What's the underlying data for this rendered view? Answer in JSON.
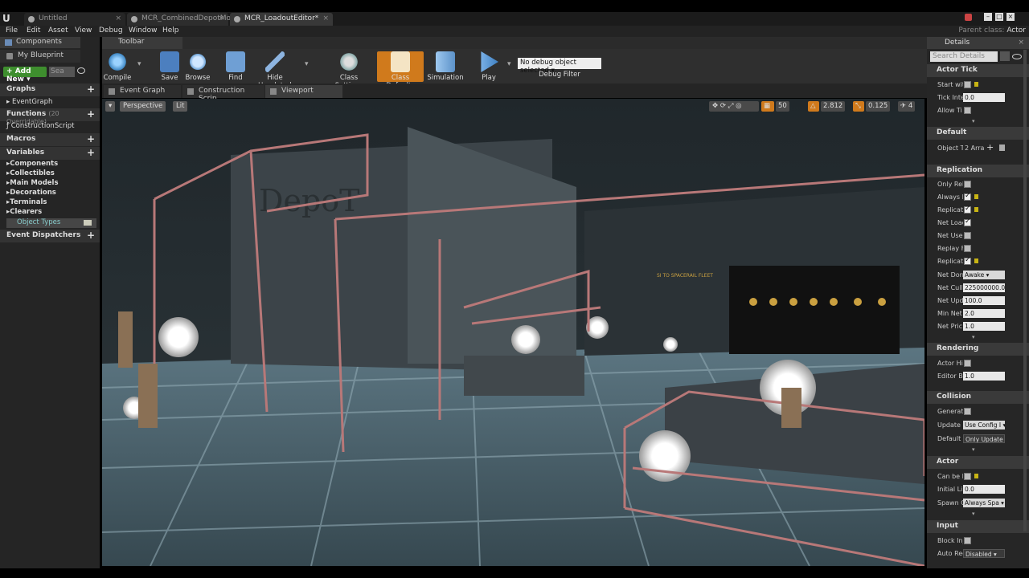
{
  "tabs": [
    "Untitled",
    "MCR_CombinedDepotMoc",
    "MCR_LoadoutEditor*"
  ],
  "menu": [
    "File",
    "Edit",
    "Asset",
    "View",
    "Debug",
    "Window",
    "Help"
  ],
  "parent_class": {
    "label": "Parent class:",
    "value": "Actor"
  },
  "left": {
    "components_tab": "Components",
    "blueprint_name": "My Blueprint",
    "add_new": "Add New",
    "search_placeholder": "Sea",
    "graphs": "Graphs",
    "event_graph": "EventGraph",
    "functions": "Functions",
    "functions_count": "(20 Overridable)",
    "construction_script": "ConstructionScript",
    "macros": "Macros",
    "variables": "Variables",
    "var_items": [
      "Components",
      "Collectibles",
      "Main Models",
      "Decorations",
      "Terminals",
      "Clearers"
    ],
    "object_types": "Object Types",
    "event_dispatchers": "Event Dispatchers"
  },
  "toolbar": {
    "tab": "Toolbar",
    "buttons": [
      "Compile",
      "Save",
      "Browse",
      "Find",
      "Hide Unrelated",
      "Class Settings",
      "Class Defaults",
      "Simulation",
      "Play"
    ],
    "debug_select": "No debug object selected",
    "debug_filter": "Debug Filter"
  },
  "editor_tabs": [
    "Event Graph",
    "Construction Scrip",
    "Viewport"
  ],
  "viewport": {
    "perspective": "Perspective",
    "lit": "Lit",
    "grid": "50",
    "angle": "2.812",
    "scale": "0.125",
    "speed": "4",
    "sign_text": "DepoT",
    "banner_text": "SI TO SPACERAIL FLEET"
  },
  "details": {
    "title": "Details",
    "search_placeholder": "Search Details",
    "sections": {
      "actor_tick": "Actor Tick",
      "default": "Default",
      "replication": "Replication",
      "rendering": "Rendering",
      "collision": "Collision",
      "actor": "Actor",
      "input": "Input"
    },
    "rows": {
      "start_with": "Start wit",
      "tick_interval": "Tick Inte",
      "tick_val": "0.0",
      "allow_tick": "Allow Ti",
      "object_t": "Object T",
      "object_val": "2 Arra",
      "only_rel": "Only Rel",
      "always_rel": "Always R",
      "replicates": "Replicat",
      "net_load": "Net Load",
      "net_use": "Net Use",
      "replay": "Replay F",
      "replicate_m": "Replicat",
      "net_dorm": "Net Dorr",
      "net_dorm_val": "Awake",
      "net_cull": "Net Cull",
      "net_cull_val": "225000000.0",
      "net_upd": "Net Upd",
      "net_upd_val": "100.0",
      "min_net": "Min Net",
      "min_net_val": "2.0",
      "net_prio": "Net Pric",
      "net_prio_val": "1.0",
      "actor_hid": "Actor Hi",
      "editor_bi": "Editor Bi",
      "editor_bi_val": "1.0",
      "generate": "Generate",
      "update_c": "Update C",
      "update_c_val": "Use Config I",
      "default_u": "Default U",
      "default_u_val": "Only Update",
      "can_be": "Can be D",
      "initial_li": "Initial Li",
      "initial_li_val": "0.0",
      "spawn_c": "Spawn C",
      "spawn_c_val": "Always Spa",
      "block_in": "Block Inj",
      "auto_rec": "Auto Rec",
      "auto_rec_val": "Disabled"
    }
  },
  "colors": {
    "accent": "#d07a1c",
    "add_green": "#3e8e2e",
    "frame_pink": "#b87878"
  }
}
